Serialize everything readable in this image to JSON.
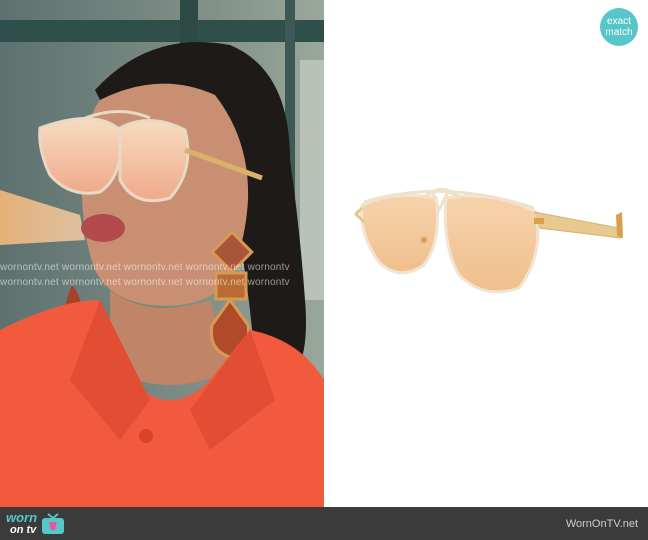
{
  "badge": {
    "line1": "exact",
    "line2": "match"
  },
  "watermark": {
    "row1": "wornontv.net  wornontv.net  wornontv.net  wornontv.net  wornontv",
    "row2": "wornontv.net  wornontv.net  wornontv.net  wornontv.net  wornontv"
  },
  "footer": {
    "logo_line1": "worn",
    "logo_line2": "on tv",
    "site": "WornOnTV.net"
  },
  "colors": {
    "accent": "#56c6c9",
    "footer_bg": "#3b3b3b",
    "shirt": "#f25a3e",
    "lens": "#f3c79a"
  }
}
